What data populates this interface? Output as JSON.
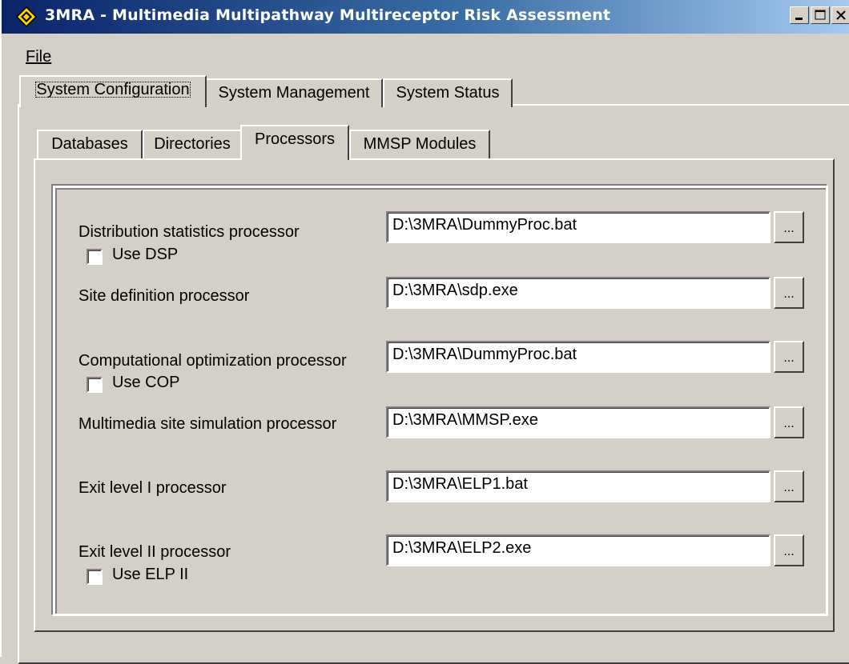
{
  "window": {
    "title": "3MRA - Multimedia Multipathway Multireceptor Risk Assessment",
    "icon": "3mra-app-icon",
    "controls": [
      "minimize-icon",
      "maximize-icon",
      "close-icon"
    ]
  },
  "menu": {
    "file": "File"
  },
  "outer_tabs": [
    {
      "label": "System Configuration",
      "active": true
    },
    {
      "label": "System Management",
      "active": false
    },
    {
      "label": "System Status",
      "active": false
    }
  ],
  "inner_tabs": [
    {
      "label": "Databases",
      "active": false
    },
    {
      "label": "Directories",
      "active": false
    },
    {
      "label": "Processors",
      "active": true
    },
    {
      "label": "MMSP Modules",
      "active": false
    }
  ],
  "processors": [
    {
      "label": "Distribution statistics processor",
      "path": "D:\\3MRA\\DummyProc.bat",
      "checkbox": {
        "label": "Use DSP",
        "checked": false
      }
    },
    {
      "label": "Site definition processor",
      "path": "D:\\3MRA\\sdp.exe"
    },
    {
      "label": "Computational optimization processor",
      "path": "D:\\3MRA\\DummyProc.bat",
      "checkbox": {
        "label": "Use COP",
        "checked": false
      }
    },
    {
      "label": "Multimedia site simulation processor",
      "path": "D:\\3MRA\\MMSP.exe"
    },
    {
      "label": "Exit level I processor",
      "path": "D:\\3MRA\\ELP1.bat"
    },
    {
      "label": "Exit level II processor",
      "path": "D:\\3MRA\\ELP2.exe",
      "checkbox": {
        "label": "Use ELP II",
        "checked": false
      }
    }
  ],
  "browse_label": "...",
  "colors": {
    "titlebar_start": "#0a246a",
    "titlebar_end": "#a6caf0",
    "face": "#d4d0c8"
  }
}
